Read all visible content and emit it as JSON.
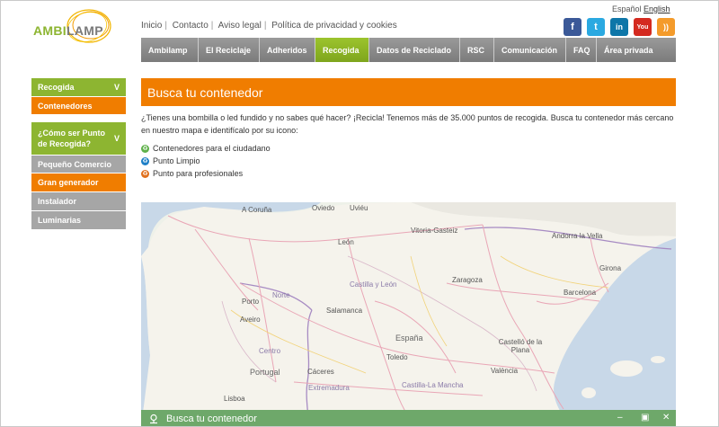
{
  "logo": {
    "part_a": "AMBI",
    "part_b": "LAMP"
  },
  "toplinks": [
    "Inicio",
    "Contacto",
    "Aviso legal",
    "Política de privacidad y cookies"
  ],
  "lang": {
    "es": "Español",
    "en": "English"
  },
  "social": [
    {
      "icon": "facebook-icon",
      "glyph": "f",
      "color": "#3b5998"
    },
    {
      "icon": "twitter-icon",
      "glyph": "t",
      "color": "#2ba9e1"
    },
    {
      "icon": "linkedin-icon",
      "glyph": "in",
      "color": "#0e76a8"
    },
    {
      "icon": "youtube-icon",
      "glyph": "You",
      "color": "#d42a20"
    },
    {
      "icon": "rss-icon",
      "glyph": "))",
      "color": "#f49b2b"
    }
  ],
  "nav": [
    "Ambilamp",
    "El Reciclaje",
    "Adheridos",
    "Recogida",
    "Datos de Reciclado",
    "RSC",
    "Comunicación",
    "FAQ",
    "Área privada"
  ],
  "nav_active": "Recogida",
  "sidebar": {
    "section1": {
      "title": "Recogida",
      "chevron": "V",
      "items": [
        "Contenedores"
      ]
    },
    "section2": {
      "title": "¿Cómo ser Punto de Recogida?",
      "chevron": "V",
      "items": [
        "Pequeño Comercio",
        "Gran generador",
        "Instalador",
        "Luminarias"
      ]
    }
  },
  "main": {
    "banner": "Busca tu contenedor",
    "intro": "¿Tienes una bombilla o led fundido y no sabes qué hacer? ¡Recicla! Tenemos más de 35.000 puntos de recogida. Busca tu contenedor más cercano en nuestro mapa e identifícalo por su icono:",
    "legend": [
      {
        "label": "Contenedores para el ciudadano",
        "color": "#5fb14a"
      },
      {
        "label": "Punto Limpio",
        "color": "#1e7fc6"
      },
      {
        "label": "Punto para profesionales",
        "color": "#e0701d"
      }
    ]
  },
  "map": {
    "labels": {
      "a_coruna": "A Coruña",
      "oviedo": "Oviedo",
      "uvieu": "Uviéu",
      "vitoria": "Vitoria-Gasteiz",
      "andorra": "Andorra la Vella",
      "leon": "León",
      "girona": "Girona",
      "castilla_leon": "Castilla y León",
      "zaragoza": "Zaragoza",
      "porto": "Porto",
      "norte": "Norte",
      "barcelona": "Barcelona",
      "salamanca": "Salamanca",
      "aveiro": "Aveiro",
      "espana": "España",
      "centro": "Centro",
      "castello": "Castelló de la Plana",
      "portugal": "Portugal",
      "caceres": "Cáceres",
      "toledo": "Toledo",
      "valencia": "València",
      "extremadura": "Extremadura",
      "castilla_mancha": "Castilla-La Mancha",
      "lisboa": "Lisboa"
    },
    "bar_title": "Busca tu contenedor",
    "bar_icon": "location-pin-icon"
  }
}
